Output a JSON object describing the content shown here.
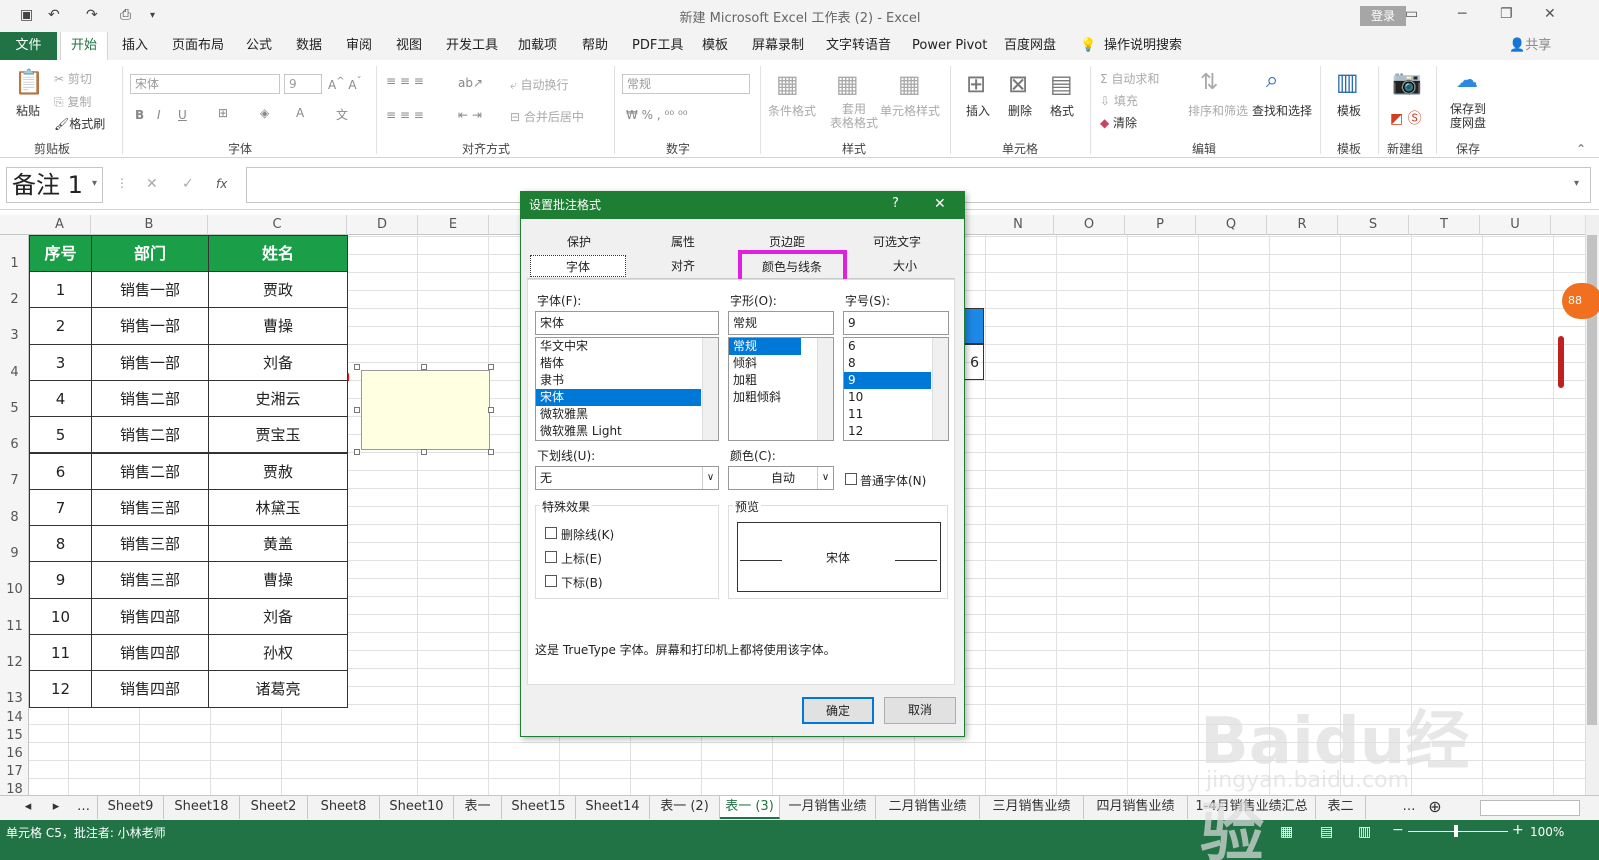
{
  "window": {
    "title": "新建 Microsoft Excel 工作表 (2)  -  Excel",
    "login": "登录"
  },
  "menu": {
    "file": "文件",
    "tabs": [
      "开始",
      "插入",
      "页面布局",
      "公式",
      "数据",
      "审阅",
      "视图",
      "开发工具",
      "加载项",
      "帮助",
      "PDF工具",
      "模板",
      "屏幕录制",
      "文字转语音",
      "Power Pivot",
      "百度网盘",
      "操作说明搜索"
    ],
    "share": "共享"
  },
  "ribbon": {
    "paste": "粘贴",
    "cut": "剪切",
    "copy": "复制",
    "format_painter": "格式刷",
    "clipboard": "剪贴板",
    "font_name": "宋体",
    "font_size": "9",
    "font_group": "字体",
    "wrap": "自动换行",
    "merge": "合并后居中",
    "align_group": "对齐方式",
    "number_format": "常规",
    "number_group": "数字",
    "cond_format": "条件格式",
    "table_format": "套用\n表格格式",
    "cell_style": "单元格样式",
    "style_group": "样式",
    "insert": "插入",
    "delete": "删除",
    "format": "格式",
    "cells_group": "单元格",
    "autosum": "自动求和",
    "fill": "填充",
    "clear": "清除",
    "sort": "排序和筛选",
    "find": "查找和选择",
    "edit_group": "编辑",
    "template": "模板",
    "template_group": "模板",
    "new_group": "新建组",
    "save_to": "保存到\n度网盘",
    "save_group": "保存"
  },
  "formula_bar": {
    "name_box": "备注 1",
    "fx": "fx",
    "value": ""
  },
  "columns": [
    "A",
    "B",
    "C",
    "D",
    "E",
    "N",
    "O",
    "P",
    "Q",
    "R",
    "S",
    "T",
    "U"
  ],
  "rows": [
    "1",
    "2",
    "3",
    "4",
    "5",
    "6",
    "7",
    "8",
    "9",
    "10",
    "11",
    "12",
    "13",
    "14",
    "15",
    "16",
    "17",
    "18"
  ],
  "table": {
    "headers": [
      "序号",
      "部门",
      "姓名"
    ],
    "rows": [
      [
        "1",
        "销售一部",
        "贾政"
      ],
      [
        "2",
        "销售一部",
        "曹操"
      ],
      [
        "3",
        "销售一部",
        "刘备"
      ],
      [
        "4",
        "销售二部",
        "史湘云"
      ],
      [
        "5",
        "销售二部",
        "贾宝玉"
      ],
      [
        "6",
        "销售二部",
        "贾赦"
      ],
      [
        "7",
        "销售三部",
        "林黛玉"
      ],
      [
        "8",
        "销售三部",
        "黄盖"
      ],
      [
        "9",
        "销售三部",
        "曹操"
      ],
      [
        "10",
        "销售四部",
        "刘备"
      ],
      [
        "11",
        "销售四部",
        "孙权"
      ],
      [
        "12",
        "销售四部",
        "诸葛亮"
      ]
    ]
  },
  "partial_cell": "6",
  "sheets": [
    "Sheet9",
    "Sheet18",
    "Sheet2",
    "Sheet8",
    "Sheet10",
    "表一",
    "Sheet15",
    "Sheet14",
    "表一 (2)",
    "表一 (3)",
    "一月销售业绩",
    "二月销售业绩",
    "三月销售业绩",
    "四月销售业绩",
    "1-4月销售业绩汇总",
    "表二"
  ],
  "active_sheet": "表一 (3)",
  "status": {
    "left": "单元格 C5，批注者: 小林老师",
    "zoom": "100%"
  },
  "dialog": {
    "title": "设置批注格式",
    "help": "?",
    "close": "✕",
    "tabs_top": [
      "保护",
      "属性",
      "页边距",
      "可选文字"
    ],
    "tabs_bottom": [
      "字体",
      "对齐",
      "颜色与线条",
      "大小"
    ],
    "font_label": "字体(F):",
    "font_value": "宋体",
    "font_list": [
      "华文中宋",
      "楷体",
      "隶书",
      "宋体",
      "微软雅黑",
      "微软雅黑 Light"
    ],
    "style_label": "字形(O):",
    "style_value": "常规",
    "style_list": [
      "常规",
      "倾斜",
      "加粗",
      "加粗倾斜"
    ],
    "size_label": "字号(S):",
    "size_value": "9",
    "size_list": [
      "6",
      "8",
      "9",
      "10",
      "11",
      "12"
    ],
    "underline_label": "下划线(U):",
    "underline_value": "无",
    "color_label": "颜色(C):",
    "color_value": "自动",
    "normal_font": "普通字体(N)",
    "effects_label": "特殊效果",
    "strike": "删除线(K)",
    "super": "上标(E)",
    "sub": "下标(B)",
    "preview_label": "预览",
    "preview_text": "宋体",
    "note": "这是 TrueType 字体。屏幕和打印机上都将使用该字体。",
    "ok": "确定",
    "cancel": "取消"
  },
  "watermark": "Baidu经验",
  "watermark_sub": "jingyan.baidu.com",
  "colors": {
    "excel_green": "#217346",
    "header_green": "#1a9e48",
    "highlight": "#e020e0",
    "selection": "#0078d7"
  }
}
